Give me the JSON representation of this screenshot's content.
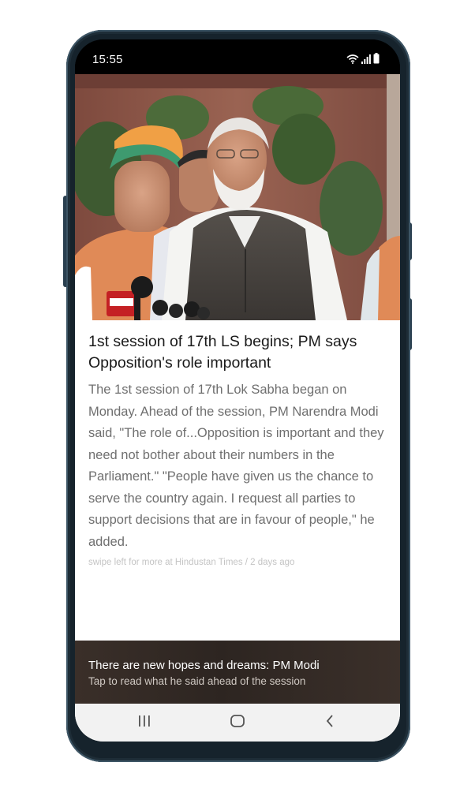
{
  "status_bar": {
    "time": "15:55",
    "icons": [
      "wifi-icon",
      "signal-icon",
      "battery-icon"
    ]
  },
  "hero_image": {
    "description_icon": "news-photo"
  },
  "article": {
    "headline": "1st session of 17th LS begins; PM says Opposition's role important",
    "body": "The 1st session of 17th Lok Sabha began on Monday. Ahead of the session, PM Narendra Modi said, \"The role of...Opposition is important and they need not bother about their numbers in the Parliament.\" \"People have given us the chance to serve the country again. I request all parties to support decisions that are in favour of people,\" he added.",
    "source_line": "swipe left for more at Hindustan Times / 2 days ago"
  },
  "promo": {
    "title": "There are new hopes and dreams: PM Modi",
    "subtitle": "Tap to read what he said ahead of the session"
  },
  "nav_bar": {
    "buttons": [
      "recents-icon",
      "home-icon",
      "back-icon"
    ]
  },
  "colors": {
    "headline": "#1a1a1a",
    "body": "#6f6f6f",
    "source": "#c4c4c4",
    "promo_bg": "#2d2521",
    "phone_frame": "#16232c"
  }
}
